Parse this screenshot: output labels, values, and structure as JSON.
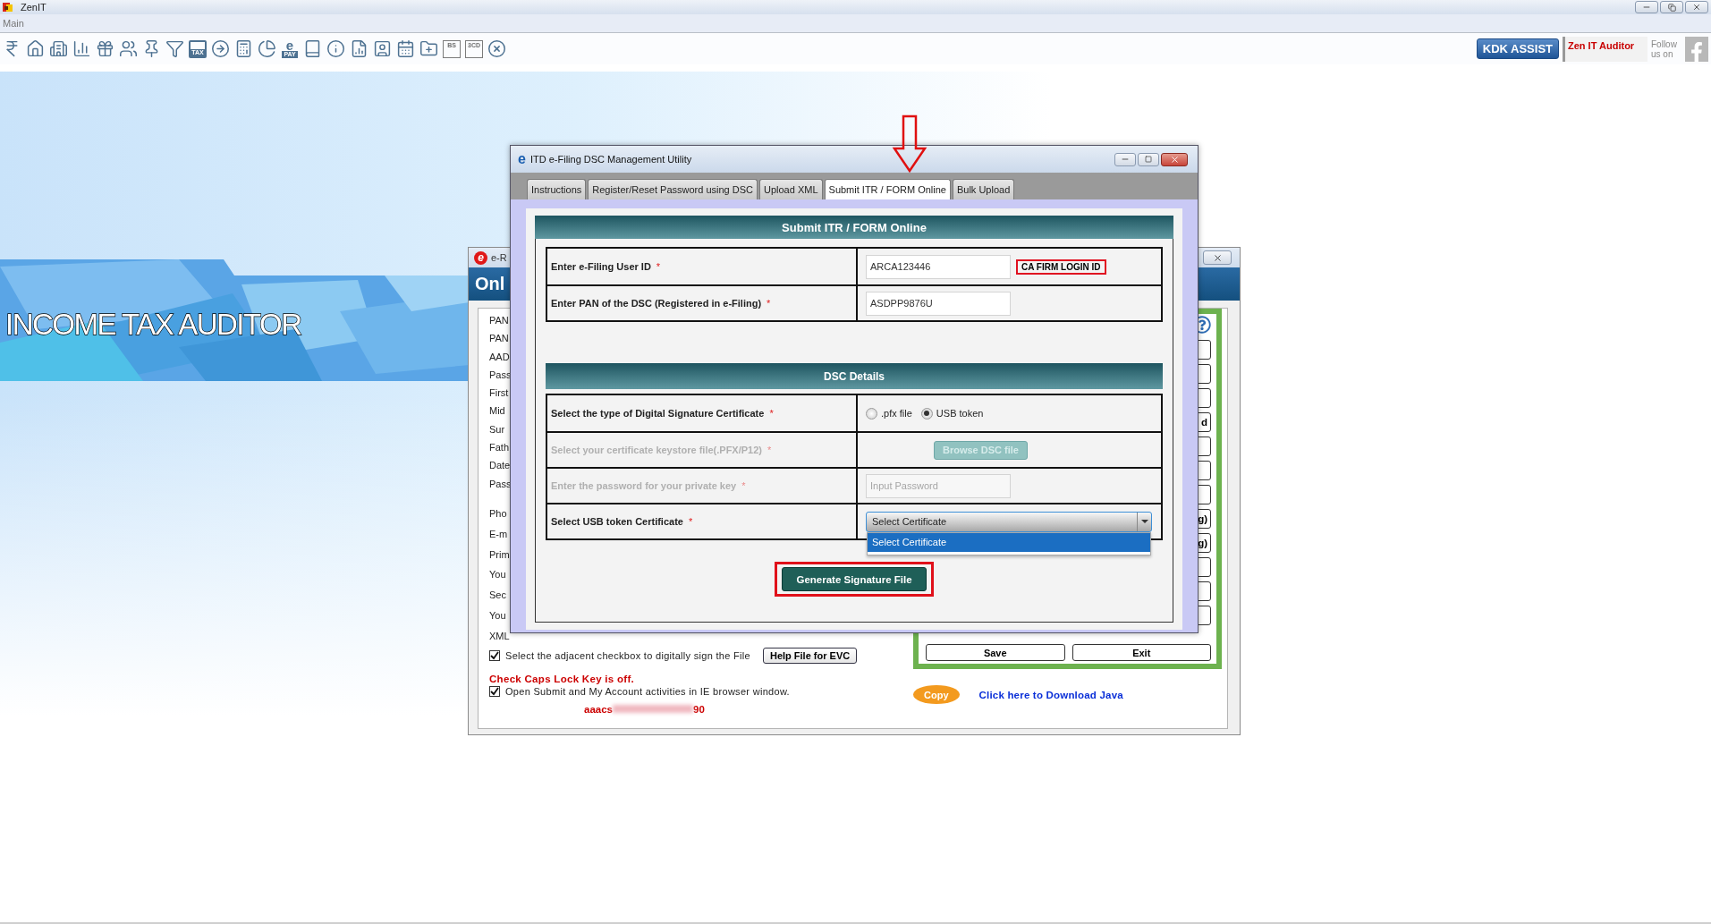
{
  "app": {
    "title": "ZenIT",
    "menu": [
      {
        "label": "Main"
      }
    ],
    "toolbar": [
      {
        "kind": "rupee"
      },
      {
        "kind": "home"
      },
      {
        "kind": "building"
      },
      {
        "kind": "chart"
      },
      {
        "kind": "gift"
      },
      {
        "kind": "users"
      },
      {
        "kind": "pin"
      },
      {
        "kind": "filter"
      },
      {
        "kind": "tax",
        "text": "TAX"
      },
      {
        "kind": "disc"
      },
      {
        "kind": "calculator"
      },
      {
        "kind": "pie"
      },
      {
        "kind": "pay",
        "mark": "e",
        "text": "PAY"
      },
      {
        "kind": "book"
      },
      {
        "kind": "info"
      },
      {
        "kind": "report"
      },
      {
        "kind": "profile"
      },
      {
        "kind": "calendar"
      },
      {
        "kind": "folder"
      },
      {
        "kind": "badge",
        "text": "BS"
      },
      {
        "kind": "badge",
        "text": "3CD"
      },
      {
        "kind": "close"
      }
    ],
    "assist_button": "KDK ASSIST",
    "product_label": "Zen IT Auditor",
    "follow_label": "Follow us on"
  },
  "banner": {
    "title": "INCOME TAX AUDITOR"
  },
  "background_window": {
    "logo_mark": "e",
    "title": "e-R",
    "header": "Onl",
    "label_groups": [
      {
        "labels": [
          "PAN",
          "PAN",
          "AAD",
          "Pass",
          "First",
          "Mid",
          "Sur",
          "Fath",
          "Date",
          "Pass"
        ]
      },
      {
        "labels": [
          "Pho",
          "E-m",
          "Prim",
          "You",
          "Sec",
          "You",
          "XML"
        ]
      }
    ],
    "side_panel_rows": [
      {
        "kind": "field"
      },
      {
        "kind": "field"
      },
      {
        "kind": "field"
      },
      {
        "kind": "button",
        "text": "d"
      },
      {
        "kind": "field"
      },
      {
        "kind": "field"
      },
      {
        "kind": "field"
      },
      {
        "kind": "button",
        "text": "g)"
      },
      {
        "kind": "button",
        "text": "g)"
      },
      {
        "kind": "field"
      },
      {
        "kind": "field"
      },
      {
        "kind": "field"
      }
    ],
    "save_button": "Save",
    "exit_button": "Exit",
    "sign_checkbox": {
      "label": "Select the adjacent checkbox to digitally sign the File",
      "checked": true
    },
    "help_button": "Help File for EVC",
    "caps_warning": "Check Caps Lock Key is off.",
    "browser_checkbox": {
      "label": "Open Submit and My Account activities in IE browser window.",
      "checked": true
    },
    "account_prefix": "aaacs",
    "account_suffix": "90",
    "copy_button": "Copy",
    "java_link": "Click here to Download Java"
  },
  "dialog": {
    "logo_mark": "e",
    "title": "ITD e-Filing DSC Management Utility",
    "tabs": [
      {
        "label": "Instructions",
        "selected": false
      },
      {
        "label": "Register/Reset Password using DSC",
        "selected": false
      },
      {
        "label": "Upload XML",
        "selected": false
      },
      {
        "label": "Submit ITR / FORM Online",
        "selected": true
      },
      {
        "label": "Bulk Upload",
        "selected": false
      }
    ],
    "heading": "Submit ITR / FORM Online",
    "login_rows": [
      {
        "label": "Enter e-Filing User ID",
        "required_mark": "*",
        "value": "ARCA123446",
        "annotation": "CA FIRM LOGIN ID"
      },
      {
        "label": "Enter PAN of the DSC (Registered in e-Filing)",
        "required_mark": "*",
        "value": "ASDPP9876U"
      }
    ],
    "dsc_heading": "DSC Details",
    "dsc_rows": [
      {
        "kind": "radio",
        "label": "Select the type of Digital Signature Certificate",
        "required_mark": "*",
        "disabled": false,
        "options": [
          {
            "label": ".pfx file",
            "selected": false
          },
          {
            "label": "USB token",
            "selected": true
          }
        ]
      },
      {
        "kind": "file",
        "label": "Select your certificate keystore file(.PFX/P12)",
        "required_mark": "*",
        "disabled": true,
        "button": "Browse DSC file"
      },
      {
        "kind": "password",
        "label": "Enter the password for your private key",
        "required_mark": "*",
        "disabled": true,
        "placeholder": "Input Password"
      },
      {
        "kind": "dropdown",
        "label": "Select USB token Certificate",
        "required_mark": "*",
        "disabled": false,
        "value": "Select Certificate",
        "expanded": true,
        "options": [
          {
            "label": "Select Certificate",
            "selected": true
          }
        ]
      }
    ],
    "generate_button": "Generate Signature File"
  }
}
